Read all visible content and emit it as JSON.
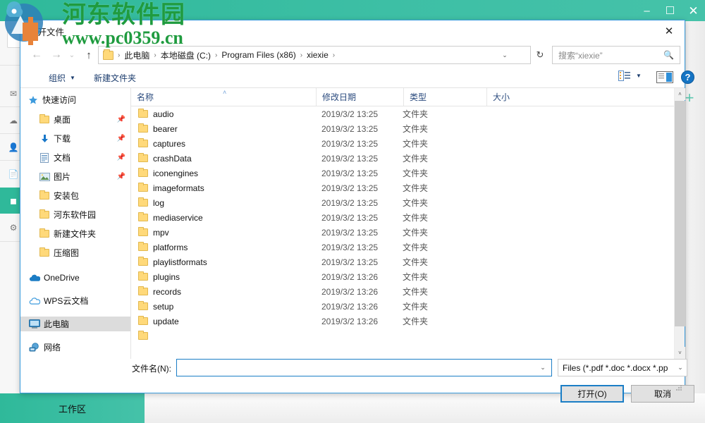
{
  "background_app": {
    "window_controls": [
      {
        "name": "minimize",
        "glyph": "–"
      },
      {
        "name": "maximize",
        "glyph": "☐"
      },
      {
        "name": "close",
        "glyph": "✕"
      }
    ],
    "rail_items": [
      {
        "label": "发",
        "icon": "send-icon"
      },
      {
        "label": "",
        "icon": "cloud-icon"
      },
      {
        "label": "我",
        "icon": "me-icon"
      },
      {
        "label": "",
        "icon": "doc-icon"
      },
      {
        "label": "",
        "icon": "selected-icon"
      },
      {
        "label": "",
        "icon": "gear-icon"
      }
    ],
    "plus_label": "+",
    "workspace_label": "工作区",
    "accent_color": "#2fb99a"
  },
  "watermark": {
    "text_cn": "河东软件园",
    "text_url": "www.pc0359.cn",
    "color": "#1f9b3f"
  },
  "dialog": {
    "title": "打开文件",
    "close_glyph": "✕",
    "nav": {
      "back_glyph": "←",
      "forward_glyph": "→",
      "recent_glyph": "⌄",
      "up_glyph": "↑",
      "refresh_glyph": "↻",
      "dropdown_glyph": "⌄"
    },
    "breadcrumb": [
      "此电脑",
      "本地磁盘 (C:)",
      "Program Files (x86)",
      "xiexie"
    ],
    "breadcrumb_separator": "›",
    "search": {
      "placeholder": "搜索“xiexie”",
      "icon": "search-icon"
    },
    "toolbar": {
      "organize_label": "组织",
      "organize_caret": "▼",
      "new_folder_label": "新建文件夹",
      "view_caret": "▼",
      "help_label": "?"
    },
    "nav_pane": {
      "items": [
        {
          "label": "快速访问",
          "icon": "star-icon",
          "pinned": false,
          "selected": false,
          "indent": 0
        },
        {
          "label": "桌面",
          "icon": "folder-icon",
          "pinned": true,
          "selected": false,
          "indent": 1
        },
        {
          "label": "下载",
          "icon": "download-icon",
          "pinned": true,
          "selected": false,
          "indent": 1
        },
        {
          "label": "文档",
          "icon": "document-icon",
          "pinned": true,
          "selected": false,
          "indent": 1
        },
        {
          "label": "图片",
          "icon": "picture-icon",
          "pinned": true,
          "selected": false,
          "indent": 1
        },
        {
          "label": "安装包",
          "icon": "folder-icon",
          "pinned": false,
          "selected": false,
          "indent": 1
        },
        {
          "label": "河东软件园",
          "icon": "folder-icon",
          "pinned": false,
          "selected": false,
          "indent": 1
        },
        {
          "label": "新建文件夹",
          "icon": "folder-icon",
          "pinned": false,
          "selected": false,
          "indent": 1
        },
        {
          "label": "压缩图",
          "icon": "folder-icon",
          "pinned": false,
          "selected": false,
          "indent": 1
        },
        {
          "label": "OneDrive",
          "icon": "onedrive-icon",
          "pinned": false,
          "selected": false,
          "indent": 0
        },
        {
          "label": "WPS云文档",
          "icon": "wpscloud-icon",
          "pinned": false,
          "selected": false,
          "indent": 0
        },
        {
          "label": "此电脑",
          "icon": "computer-icon",
          "pinned": false,
          "selected": true,
          "indent": 0
        },
        {
          "label": "网络",
          "icon": "network-icon",
          "pinned": false,
          "selected": false,
          "indent": 0
        }
      ]
    },
    "columns": {
      "name": "名称",
      "date": "修改日期",
      "type": "类型",
      "size": "大小",
      "sort_caret": "˄"
    },
    "files": [
      {
        "name": "audio",
        "date": "2019/3/2 13:25",
        "type": "文件夹",
        "size": ""
      },
      {
        "name": "bearer",
        "date": "2019/3/2 13:25",
        "type": "文件夹",
        "size": ""
      },
      {
        "name": "captures",
        "date": "2019/3/2 13:25",
        "type": "文件夹",
        "size": ""
      },
      {
        "name": "crashData",
        "date": "2019/3/2 13:25",
        "type": "文件夹",
        "size": ""
      },
      {
        "name": "iconengines",
        "date": "2019/3/2 13:25",
        "type": "文件夹",
        "size": ""
      },
      {
        "name": "imageformats",
        "date": "2019/3/2 13:25",
        "type": "文件夹",
        "size": ""
      },
      {
        "name": "log",
        "date": "2019/3/2 13:25",
        "type": "文件夹",
        "size": ""
      },
      {
        "name": "mediaservice",
        "date": "2019/3/2 13:25",
        "type": "文件夹",
        "size": ""
      },
      {
        "name": "mpv",
        "date": "2019/3/2 13:25",
        "type": "文件夹",
        "size": ""
      },
      {
        "name": "platforms",
        "date": "2019/3/2 13:25",
        "type": "文件夹",
        "size": ""
      },
      {
        "name": "playlistformats",
        "date": "2019/3/2 13:25",
        "type": "文件夹",
        "size": ""
      },
      {
        "name": "plugins",
        "date": "2019/3/2 13:26",
        "type": "文件夹",
        "size": ""
      },
      {
        "name": "records",
        "date": "2019/3/2 13:26",
        "type": "文件夹",
        "size": ""
      },
      {
        "name": "setup",
        "date": "2019/3/2 13:26",
        "type": "文件夹",
        "size": ""
      },
      {
        "name": "update",
        "date": "2019/3/2 13:26",
        "type": "文件夹",
        "size": ""
      }
    ],
    "scrollbar": {
      "up_glyph": "˄",
      "down_glyph": "˅"
    },
    "bottom": {
      "filename_label": "文件名(N):",
      "filename_value": "",
      "filename_caret": "⌄",
      "filter_value": "Files (*.pdf *.doc *.docx *.pp",
      "filter_caret": "⌄",
      "open_label": "打开(O)",
      "cancel_label": "取消"
    }
  }
}
